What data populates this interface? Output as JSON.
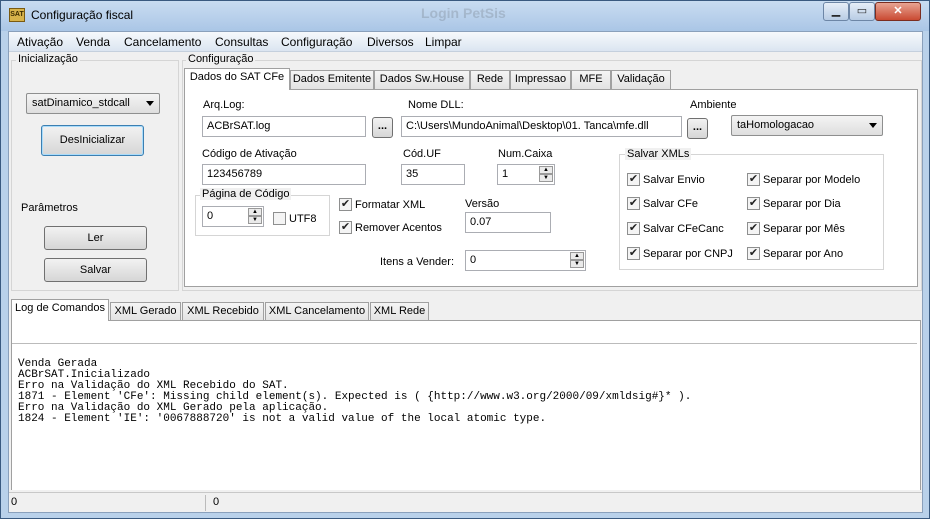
{
  "window": {
    "title": "Configuração fiscal",
    "icon_text": "SAT",
    "ghost_title": "Login PetSis",
    "min": "▁",
    "max": "▭",
    "close": "✕"
  },
  "menu": [
    "Ativação",
    "Venda",
    "Cancelamento",
    "Consultas",
    "Configuração",
    "Diversos",
    "Limpar"
  ],
  "init": {
    "group": "Inicialização",
    "library": "satDinamico_stdcall",
    "button": "DesInicializar"
  },
  "params": {
    "group": "Parâmetros",
    "read": "Ler",
    "save": "Salvar"
  },
  "config": {
    "group": "Configuração"
  },
  "tabs": [
    "Dados do SAT CFe",
    "Dados Emitente",
    "Dados Sw.House",
    "Rede",
    "Impressao",
    "MFE",
    "Validação"
  ],
  "sat": {
    "arq_log_label": "Arq.Log:",
    "arq_log": "ACBrSAT.log",
    "browse": "...",
    "dll_label": "Nome DLL:",
    "dll": "C:\\Users\\MundoAnimal\\Desktop\\01. Tanca\\mfe.dll",
    "ambiente_label": "Ambiente",
    "ambiente": "taHomologacao",
    "cod_ativ_label": "Código de Ativação",
    "cod_ativ": "123456789",
    "uf_label": "Cód.UF",
    "uf": "35",
    "caixa_label": "Num.Caixa",
    "caixa": "1",
    "pagina_label": "Página de Código",
    "pagina": "0",
    "utf8": "UTF8",
    "formatar": "Formatar XML",
    "remover": "Remover Acentos",
    "versao_label": "Versão",
    "versao": "0.07",
    "itens_label": "Itens a Vender:",
    "itens": "0",
    "xml_group": "Salvar XMLs",
    "xml_checks": [
      "Salvar Envio",
      "Salvar CFe",
      "Salvar CFeCanc",
      "Separar por CNPJ",
      "Separar por Modelo",
      "Separar por Dia",
      "Separar por Mês",
      "Separar por Ano"
    ],
    "check": "✔"
  },
  "bottom_tabs": [
    "Log de Comandos",
    "XML Gerado",
    "XML Recebido",
    "XML Cancelamento",
    "XML Rede"
  ],
  "log_lines": [
    "Venda Gerada",
    "ACBrSAT.Inicializado",
    "Erro na Validação do XML Recebido do SAT.",
    "1871 - Element 'CFe': Missing child element(s). Expected is ( {http://www.w3.org/2000/09/xmldsig#}* ).",
    "Erro na Validação do XML Gerado pela aplicação.",
    "1824 - Element 'IE': '0067888720' is not a valid value of the local atomic type."
  ],
  "status": {
    "left": "0",
    "right": "0"
  }
}
